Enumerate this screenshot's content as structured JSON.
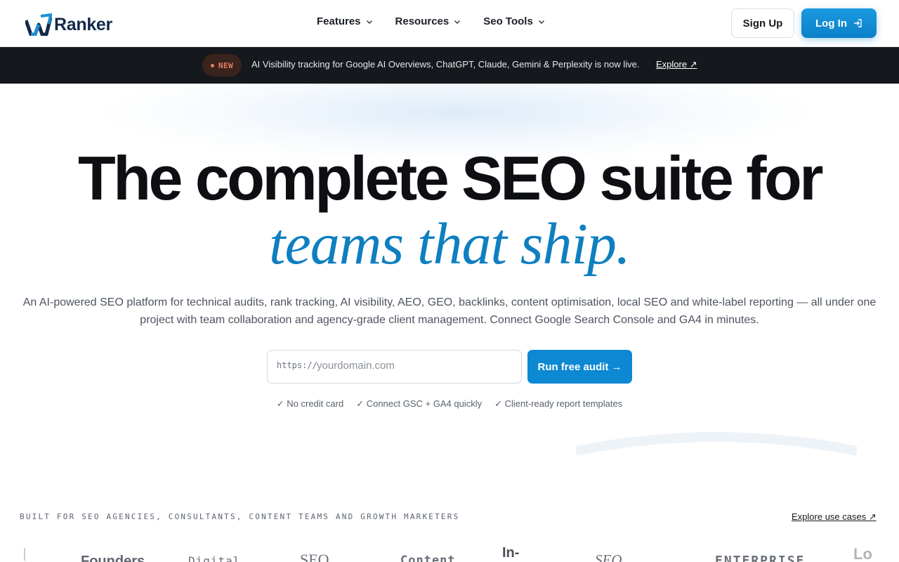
{
  "header": {
    "brand": "Ranker",
    "nav": [
      {
        "label": "Features"
      },
      {
        "label": "Resources"
      },
      {
        "label": "Seo Tools"
      }
    ],
    "signup_label": "Sign Up",
    "login_label": "Log In"
  },
  "announcement": {
    "badge": "NEW",
    "text": "AI Visibility tracking for Google AI Overviews, ChatGPT, Claude, Gemini & Perplexity is now live.",
    "link": "Explore ↗"
  },
  "hero": {
    "headline": "The complete SEO suite for",
    "headline_accent": "teams that ship.",
    "subtext": "An AI-powered SEO platform for technical audits, rank tracking, AI visibility, AEO, GEO, backlinks, content optimisation, local SEO and white-label reporting — all under one project with team collaboration and agency-grade client management. Connect Google Search Console and GA4 in minutes.",
    "input_prefix": "https://",
    "input_placeholder": "yourdomain.com",
    "cta_label": "Run free audit →",
    "checks": [
      "✓ No credit card",
      "✓ Connect GSC + GA4 quickly",
      "✓ Client-ready report templates"
    ]
  },
  "audience": {
    "label": "BUILT FOR SEO AGENCIES, CONSULTANTS, CONTENT TEAMS AND GROWTH MARKETERS",
    "link": "Explore use cases ↗",
    "logos": [
      "Founders",
      "Digital",
      "SEO",
      "Content",
      "In-",
      "SEO",
      "ENTERPRISE",
      "Lo"
    ]
  },
  "colors": {
    "accent": "#0d88d2",
    "accent_text": "#0e7fc0",
    "dark_bar": "#15181d",
    "badge": "#e87e5a"
  }
}
